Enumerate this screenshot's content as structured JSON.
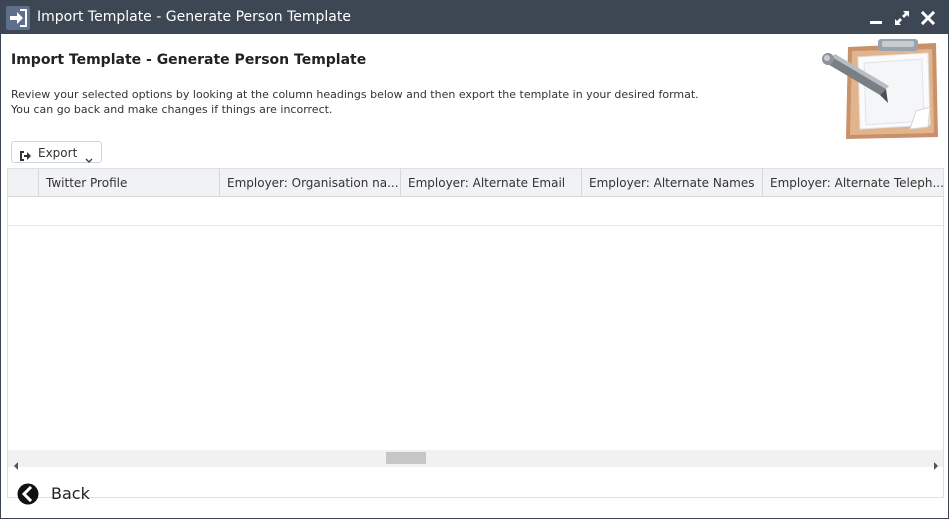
{
  "window": {
    "title": "Import Template - Generate Person Template",
    "controls": [
      "minimize-icon",
      "maximize-icon",
      "close-icon"
    ]
  },
  "page": {
    "title": "Import Template - Generate Person Template",
    "description_line1": "Review your selected options by looking at the column headings below and then export the template in your desired format.",
    "description_line2": "You can go back and make changes if things are incorrect."
  },
  "toolbar": {
    "export_label": "Export",
    "export_icon": "export-icon"
  },
  "grid": {
    "columns": [
      "",
      "Twitter Profile",
      "Employer: Organisation na...",
      "Employer: Alternate Email",
      "Employer: Alternate Names",
      "Employer: Alternate Teleph..."
    ],
    "rows": []
  },
  "footer": {
    "back_label": "Back",
    "back_icon": "back-arrow-icon"
  },
  "colors": {
    "titlebar": "#3d4653",
    "header_bg": "#f1f2f4"
  }
}
